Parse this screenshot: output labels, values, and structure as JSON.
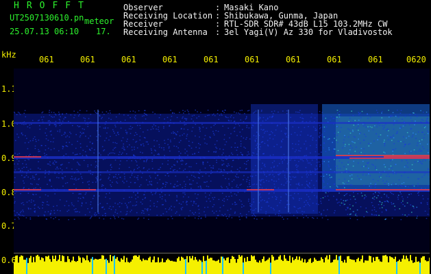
{
  "app": {
    "name": "HROFFT",
    "file_name": "UT2507130610.pn",
    "meteor_label": "meteor",
    "datetime": "25.07.13 06:10",
    "count": "17."
  },
  "info": {
    "rows": [
      {
        "label": "Observer",
        "value": "Masaki Kano"
      },
      {
        "label": "Receiving Location",
        "value": "Shibukawa, Gunma, Japan"
      },
      {
        "label": "Receiver",
        "value": "RTL-SDR SDR# 43dB L15 103.2MHz CW"
      },
      {
        "label": "Receiving Antenna",
        "value": "3el Yagi(V) Az 330 for Vladivostok"
      }
    ],
    "separator": ":"
  },
  "axis": {
    "unit": "kHz",
    "y_ticks": [
      "1.1",
      "1.0",
      "0.9",
      "0.8",
      "0.7",
      "0.6"
    ],
    "time_labels": [
      "061",
      "061",
      "061",
      "061",
      "061",
      "061",
      "061",
      "061",
      "061",
      "0620"
    ]
  },
  "colors": {
    "background": "#000000",
    "header_green": "#2df22d",
    "header_white": "#f2f2f2",
    "axis_yellow": "#f5f000",
    "noise_floor": "#1a2ec8",
    "band_signal": "#ff3a3a",
    "level_bar": "#f5f000",
    "level_cyan": "#19c4ff"
  }
}
